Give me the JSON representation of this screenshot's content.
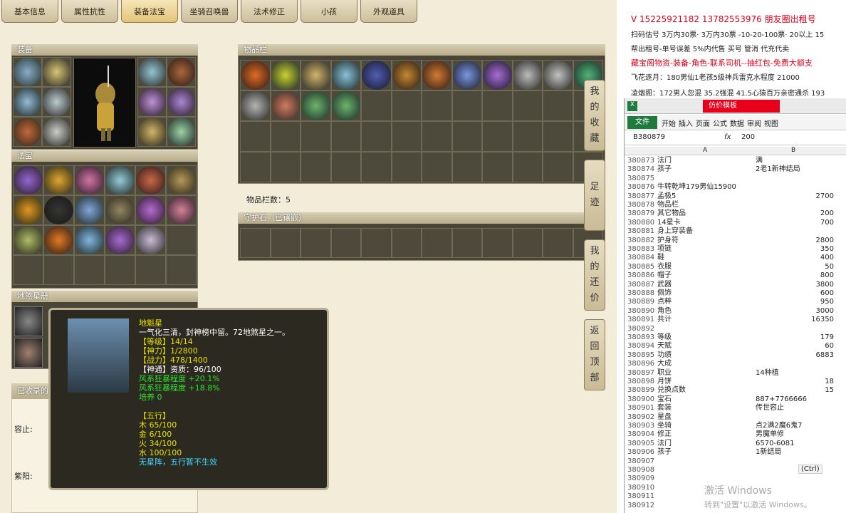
{
  "tabs": [
    "基本信息",
    "属性抗性",
    "装备法宝",
    "坐骑召唤兽",
    "法术修正",
    "小孩",
    "外观道具"
  ],
  "sections": {
    "equip": "装备",
    "fabao": "法宝",
    "dishaxingce": "地煞星册",
    "inventory": "物品栏",
    "guard": "守护石（已镶嵌）",
    "collected": "已收录的",
    "inventory_count": "物品栏数：5",
    "rong": "容止:",
    "ziyang": "紫阳:"
  },
  "side_buttons": [
    {
      "label": "我的收藏"
    },
    {
      "label": "足迹"
    },
    {
      "label": "我的还价"
    },
    {
      "label": "返回顶部"
    }
  ],
  "tooltip": {
    "name": "地魁星",
    "desc": "一气化三清，封神榜中留。72地煞星之一。",
    "level": "【等级】14/14",
    "shenli": "【神力】1/2800",
    "zhanli": "【战力】478/1400",
    "shentong": "【神通】资质：96/100",
    "feng1": "风系狂暴程度 +20.1%",
    "feng2": "风系狂暴程度 +18.8%",
    "peiyang": "培养 0",
    "wuxing": "【五行】",
    "mu": "木 65/100",
    "jin": "金 6/100",
    "huo": "火 34/100",
    "shui": "水 100/100",
    "nozhen": "无星阵，五行暂不生效"
  },
  "right_ad": {
    "line1": "V 15225921182  13782553976 朋友圈出租号",
    "line2": "扫码估号 3万内30票· 3万内30票  -10-20-100票· 20以上 15",
    "line3": "帮出租号-单号误差 5%内代售 买号 管消 代充代卖",
    "line4": "藏宝阁物资-装备-角色-联系司机--抽红包-免费大额支",
    "line5": "飞花逐月：180男仙1老孩5级神兵雷克水程度 21000",
    "line6": "凌烟阁：172男人忽混 35.2强混 41.5心猿百万亲密通杀 193"
  },
  "excel": {
    "title": "仿价模板",
    "file_tab": "文件",
    "menu": [
      "开始",
      "插入",
      "页面",
      "公式",
      "数据",
      "审阅",
      "视图"
    ],
    "namebox": "B380879",
    "fx": "fx",
    "formula": "200",
    "colA": "A",
    "colB": "B",
    "ctrl": "(Ctrl)",
    "activate": "激活 Windows",
    "activate_sub": "转到\"设置\"以激活 Windows。",
    "rows": [
      [
        "380873",
        "法门",
        "满"
      ],
      [
        "380874",
        "孩子",
        "2老1新神结局"
      ],
      [
        "380875",
        "",
        ""
      ],
      [
        "380876",
        "牛转乾坤179男仙15900",
        ""
      ],
      [
        "380877",
        "孟极5",
        "2700"
      ],
      [
        "380878",
        "物品栏",
        ""
      ],
      [
        "380879",
        "其它物品",
        "200"
      ],
      [
        "380880",
        "14星卡",
        "700"
      ],
      [
        "380881",
        "身上穿装备",
        ""
      ],
      [
        "380882",
        "护身符",
        "2800"
      ],
      [
        "380883",
        "项链",
        "350"
      ],
      [
        "380884",
        "鞋",
        "400"
      ],
      [
        "380885",
        "衣服",
        "50"
      ],
      [
        "380886",
        "帽子",
        "800"
      ],
      [
        "380887",
        "武器",
        "3800"
      ],
      [
        "380888",
        "佩饰",
        "600"
      ],
      [
        "380889",
        "点粹",
        "950"
      ],
      [
        "380890",
        "角色",
        "3000"
      ],
      [
        "380891",
        "共计",
        "16350"
      ],
      [
        "380892",
        "",
        ""
      ],
      [
        "380893",
        "等级",
        "179"
      ],
      [
        "380894",
        "天赋",
        "60"
      ],
      [
        "380895",
        "功绩",
        "6883"
      ],
      [
        "380896",
        "大成",
        ""
      ],
      [
        "380897",
        "职业",
        "14种植"
      ],
      [
        "380898",
        "月饼",
        "18"
      ],
      [
        "380899",
        "兑换点数",
        "15"
      ],
      [
        "380900",
        "宝石",
        "887+7766666"
      ],
      [
        "380901",
        "套装",
        "传世容止"
      ],
      [
        "380902",
        "星盘",
        ""
      ],
      [
        "380903",
        "坐骑",
        "点2满2魔6鬼7"
      ],
      [
        "380904",
        "修正",
        "男魔单修"
      ],
      [
        "380905",
        "法门",
        "6570-6081"
      ],
      [
        "380906",
        "孩子",
        "1新结局"
      ],
      [
        "380907",
        "",
        ""
      ],
      [
        "380908",
        "",
        ""
      ],
      [
        "380909",
        "",
        ""
      ],
      [
        "380910",
        "",
        ""
      ],
      [
        "380911",
        "",
        ""
      ],
      [
        "380912",
        "",
        ""
      ]
    ]
  }
}
